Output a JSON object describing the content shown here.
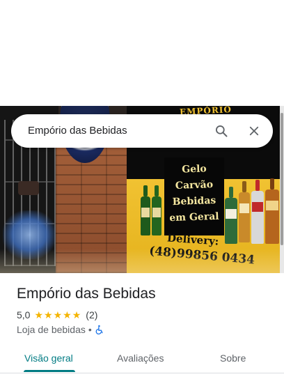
{
  "search": {
    "query": "Empório das Bebidas"
  },
  "photo": {
    "sign_brand": "EMPÓRIO",
    "sign_lines": [
      "Gelo",
      "Carvão",
      "Bebidas",
      "em Geral"
    ],
    "sign_delivery": "Delivery:",
    "sign_phone": "(48)99856 0434"
  },
  "place": {
    "name": "Empório das Bebidas",
    "rating": "5,0",
    "stars": 5,
    "review_count": "(2)",
    "category": "Loja de bebidas",
    "separator": "•"
  },
  "tabs": [
    {
      "label": "Visão geral",
      "active": true
    },
    {
      "label": "Avaliações",
      "active": false
    },
    {
      "label": "Sobre",
      "active": false
    }
  ],
  "colors": {
    "accent": "#007b83",
    "star": "#f4b400",
    "accessibility": "#1a73e8"
  },
  "icons": {
    "search": "search-icon",
    "close": "close-icon",
    "accessibility": "wheelchair-icon"
  }
}
